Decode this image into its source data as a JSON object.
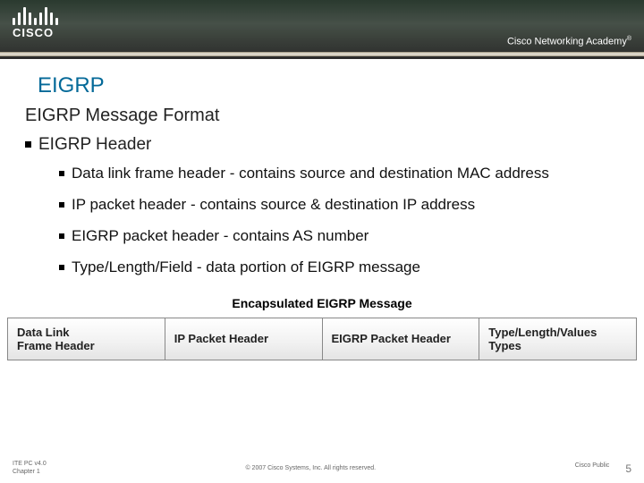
{
  "brand": {
    "name": "CISCO",
    "academy": "Cisco Networking Academy",
    "tm": "®"
  },
  "title": "EIGRP",
  "subtitle": "EIGRP Message Format",
  "header3": "EIGRP Header",
  "bullets": [
    "Data link frame header - contains source and destination MAC address",
    "IP packet header - contains source & destination IP address",
    "EIGRP packet header - contains AS number",
    "Type/Length/Field - data portion of EIGRP message"
  ],
  "encap": {
    "title": "Encapsulated EIGRP Message",
    "cells": [
      "Data Link\nFrame Header",
      "IP Packet Header",
      "EIGRP Packet Header",
      "Type/Length/Values Types"
    ]
  },
  "footer": {
    "left1": "ITE PC v4.0",
    "left2": "Chapter 1",
    "copyright": "© 2007 Cisco Systems, Inc. All rights reserved.",
    "class": "Cisco Public",
    "page": "5"
  }
}
